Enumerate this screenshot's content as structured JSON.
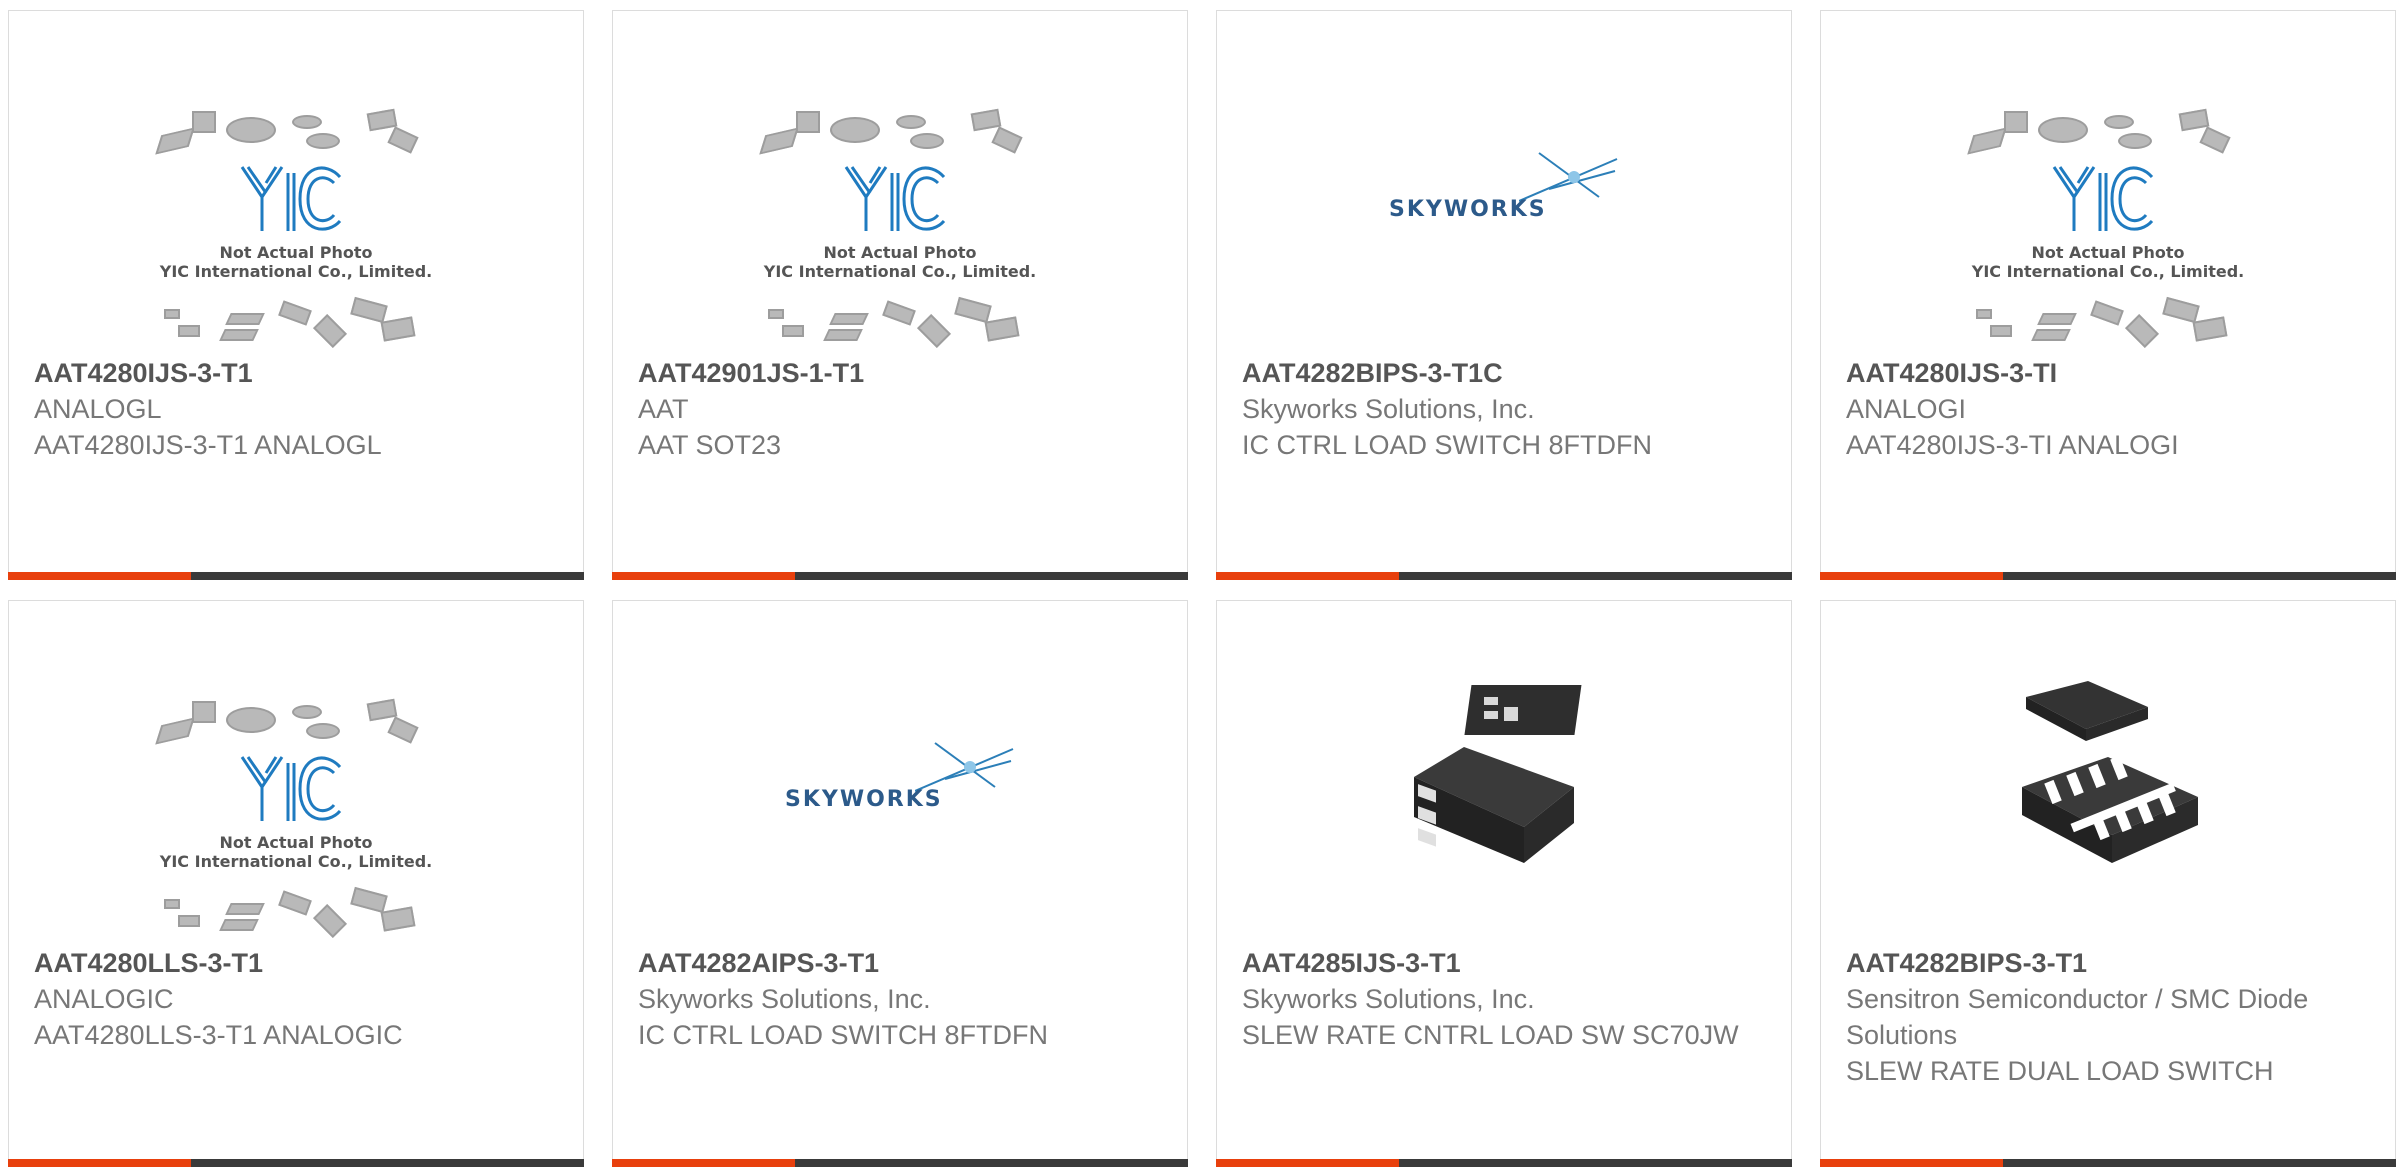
{
  "products": [
    {
      "part_number": "AAT4280IJS-3-T1",
      "manufacturer": "ANALOGL",
      "description": "AAT4280IJS-3-T1 ANALOGL",
      "image": "yic-placeholder"
    },
    {
      "part_number": "AAT42901JS-1-T1",
      "manufacturer": "AAT",
      "description": "AAT SOT23",
      "image": "yic-placeholder"
    },
    {
      "part_number": "AAT4282BIPS-3-T1C",
      "manufacturer": "Skyworks Solutions, Inc.",
      "description": "IC CTRL LOAD SWITCH 8FTDFN",
      "image": "skyworks-logo"
    },
    {
      "part_number": "AAT4280IJS-3-TI",
      "manufacturer": "ANALOGI",
      "description": "AAT4280IJS-3-TI ANALOGI",
      "image": "yic-placeholder"
    },
    {
      "part_number": "AAT4280LLS-3-T1",
      "manufacturer": "ANALOGIC",
      "description": "AAT4280LLS-3-T1 ANALOGIC",
      "image": "yic-placeholder"
    },
    {
      "part_number": "AAT4282AIPS-3-T1",
      "manufacturer": "Skyworks Solutions, Inc.",
      "description": "IC CTRL LOAD SWITCH 8FTDFN",
      "image": "skyworks-logo"
    },
    {
      "part_number": "AAT4285IJS-3-T1",
      "manufacturer": "Skyworks Solutions, Inc.",
      "description": "SLEW RATE CNTRL LOAD SW SC70JW",
      "image": "sc70-package-photo"
    },
    {
      "part_number": "AAT4282BIPS-3-T1",
      "manufacturer": "Sensitron Semiconductor / SMC Diode Solutions",
      "description": "SLEW RATE DUAL LOAD SWITCH",
      "image": "dfn-package-photo"
    }
  ],
  "placeholder": {
    "line1": "Not Actual Photo",
    "line2": "YIC International Co., Limited."
  },
  "skyworks_logo_text": "SKYWORKS",
  "colors": {
    "accent": "#e8400d",
    "bar": "#3a3a3a",
    "part_number": "#555555",
    "text": "#777777",
    "yic_blue": "#1f7bc0"
  }
}
